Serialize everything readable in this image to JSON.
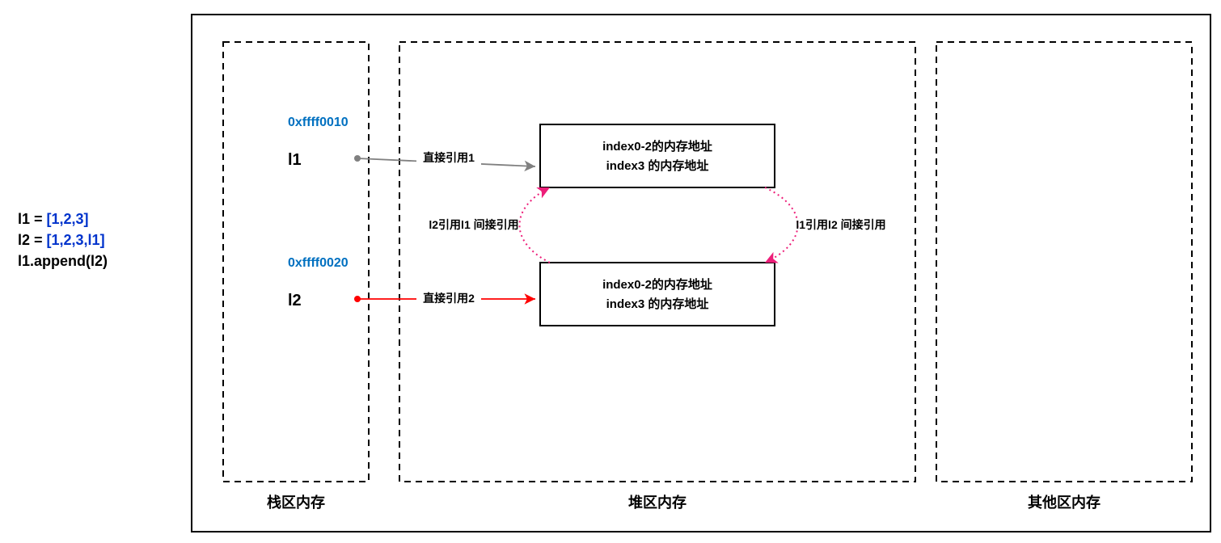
{
  "code": {
    "line1_var": "l1 = ",
    "line1_val": "[1,2,3]",
    "line2_var": "l2 = ",
    "line2_val": "[1,2,3,l1]",
    "line3": "l1.append(l2)"
  },
  "stack": {
    "addr1": "0xffff0010",
    "var1": "l1",
    "addr2": "0xffff0020",
    "var2": "l2"
  },
  "heap": {
    "box1_line1": "index0-2的内存地址",
    "box1_line2": "index3 的内存地址",
    "box2_line1": "index0-2的内存地址",
    "box2_line2": "index3 的内存地址"
  },
  "edges": {
    "direct1": "直接引用1",
    "direct2": "直接引用2",
    "left_label": "l2引用l1 间接引用",
    "right_label": "l1引用l2 间接引用"
  },
  "regions": {
    "stack": "栈区内存",
    "heap": "堆区内存",
    "other": "其他区内存"
  },
  "colors": {
    "gray": "#808080",
    "red": "#FF0000",
    "magenta": "#ED1E79",
    "addr_blue": "#0070C0",
    "code_blue": "#0033cc"
  }
}
